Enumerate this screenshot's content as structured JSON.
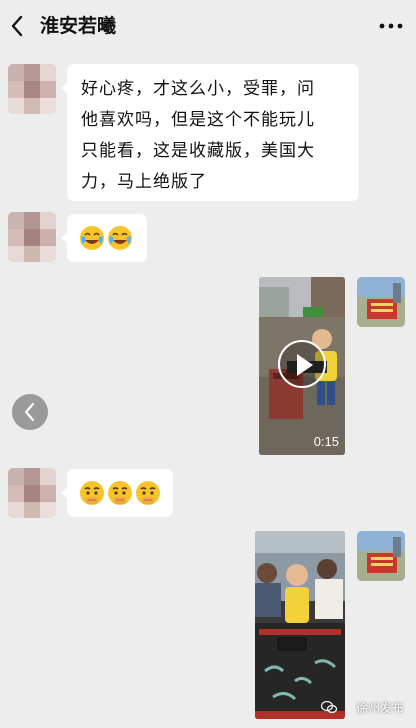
{
  "header": {
    "title": "淮安若曦"
  },
  "messages": [
    {
      "type": "text",
      "text": "好心疼，才这么小，受罪，问\n他喜欢吗，但是这个不能玩儿\n只能看，这是收藏版，美国大\n力，马上绝版了"
    },
    {
      "type": "emoji",
      "emojis": [
        "crying-laughing-emoji",
        "crying-laughing-emoji"
      ]
    },
    {
      "type": "video",
      "duration": "0:15"
    },
    {
      "type": "emoji",
      "emojis": [
        "shushing-face-emoji",
        "shushing-face-emoji",
        "shushing-face-emoji"
      ]
    },
    {
      "type": "image"
    }
  ],
  "watermark": {
    "text": "徐州发布"
  },
  "colors": {
    "background": "#ededed",
    "bubble": "#ffffff",
    "text": "#111111"
  }
}
